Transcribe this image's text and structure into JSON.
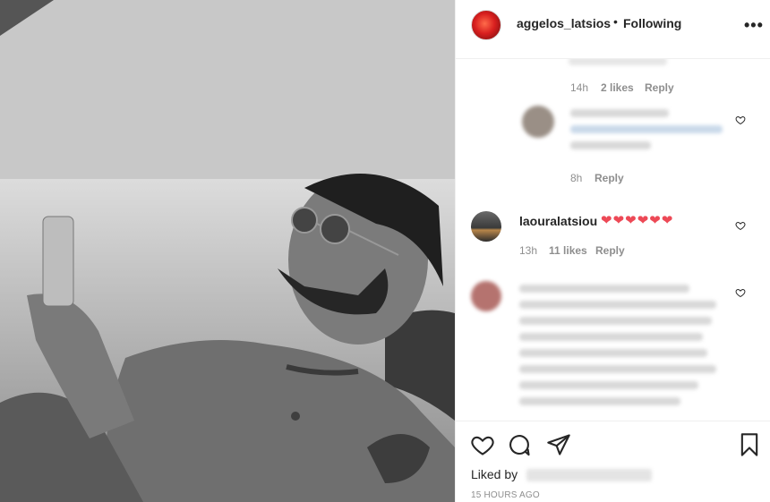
{
  "post": {
    "username": "aggelos_latsios",
    "separator": "•",
    "follow_status": "Following",
    "more_label": "•••"
  },
  "comments": [
    {
      "time": "14h",
      "likes": "2 likes",
      "reply": "Reply"
    },
    {
      "time": "8h",
      "reply": "Reply"
    },
    {
      "username": "laouralatsiou",
      "text": "❤❤❤❤❤❤",
      "time": "13h",
      "likes": "11 likes",
      "reply": "Reply"
    }
  ],
  "footer": {
    "liked_by_label": "Liked by",
    "timestamp": "15 HOURS AGO"
  },
  "icons": [
    "like-icon",
    "comment-icon",
    "share-icon",
    "save-icon",
    "more-icon"
  ],
  "colors": {
    "heart_red": "#ed4956",
    "text": "#262626",
    "muted": "#8e8e8e"
  }
}
